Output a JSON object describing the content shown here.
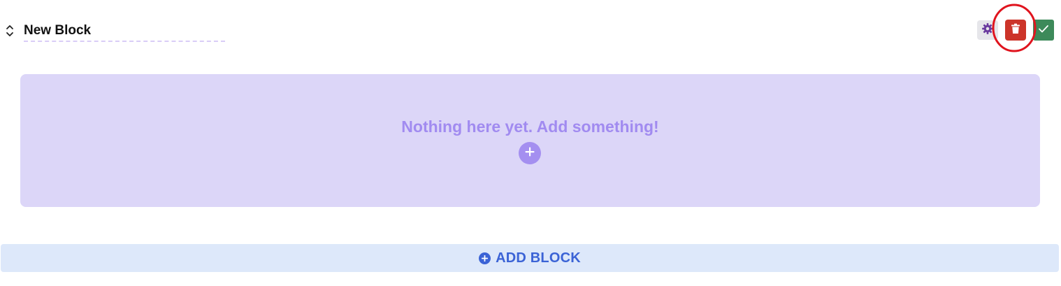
{
  "block": {
    "title_value": "New Block",
    "reorder_icon": "chevron-up-down-icon",
    "actions": {
      "settings_icon": "gear-icon",
      "delete_icon": "trash-icon",
      "confirm_icon": "checkmark-icon"
    },
    "highlight_annotation": "red-circle-around-delete"
  },
  "empty_state": {
    "message": "Nothing here yet. Add something!",
    "add_icon": "plus-circle-icon"
  },
  "add_block": {
    "label": "ADD BLOCK",
    "icon": "plus-circle-icon"
  },
  "colors": {
    "delete": "#cc3429",
    "confirm": "#3d8a5a",
    "settings_icon": "#6a3a9e",
    "empty_bg": "#dcd6f8",
    "empty_text": "#a18bf0",
    "add_block_bg": "#dde8fa",
    "add_block_text": "#3b63d6",
    "annotation": "#e0141e"
  }
}
